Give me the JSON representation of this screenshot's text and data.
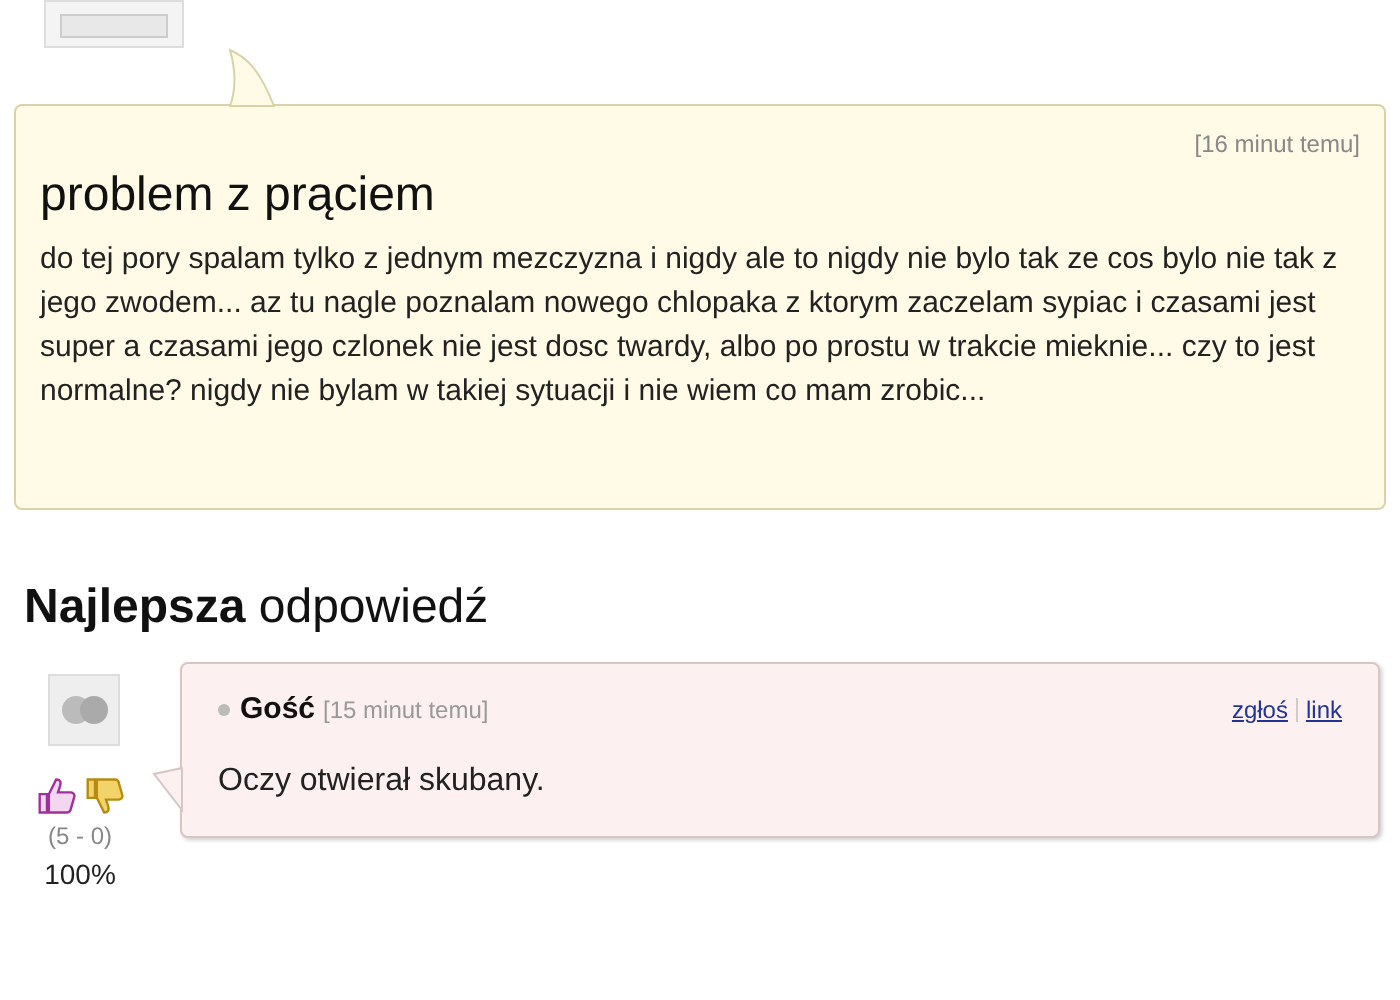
{
  "question": {
    "time": "[16 minut temu]",
    "title": "problem z prąciem",
    "body": "do tej pory spalam tylko z jednym mezczyzna i nigdy ale to nigdy nie bylo tak ze cos bylo nie tak z jego zwodem... az tu nagle poznalam nowego chlopaka z ktorym zaczelam sypiac i czasami jest super a czasami jego czlonek nie jest dosc twardy, albo po prostu w trakcie mieknie... czy to jest normalne? nigdy nie bylam w takiej sytuacji i nie wiem co mam zrobic..."
  },
  "best_answer": {
    "heading": "**Najlepsza** odpowiedź",
    "author": "Gość",
    "time": "[15 minut temu]",
    "text": "Oczy otwierał skubany.",
    "links": [
      "zgłoś",
      "link"
    ],
    "votes": "(5 - 0)",
    "percent": "100%"
  }
}
